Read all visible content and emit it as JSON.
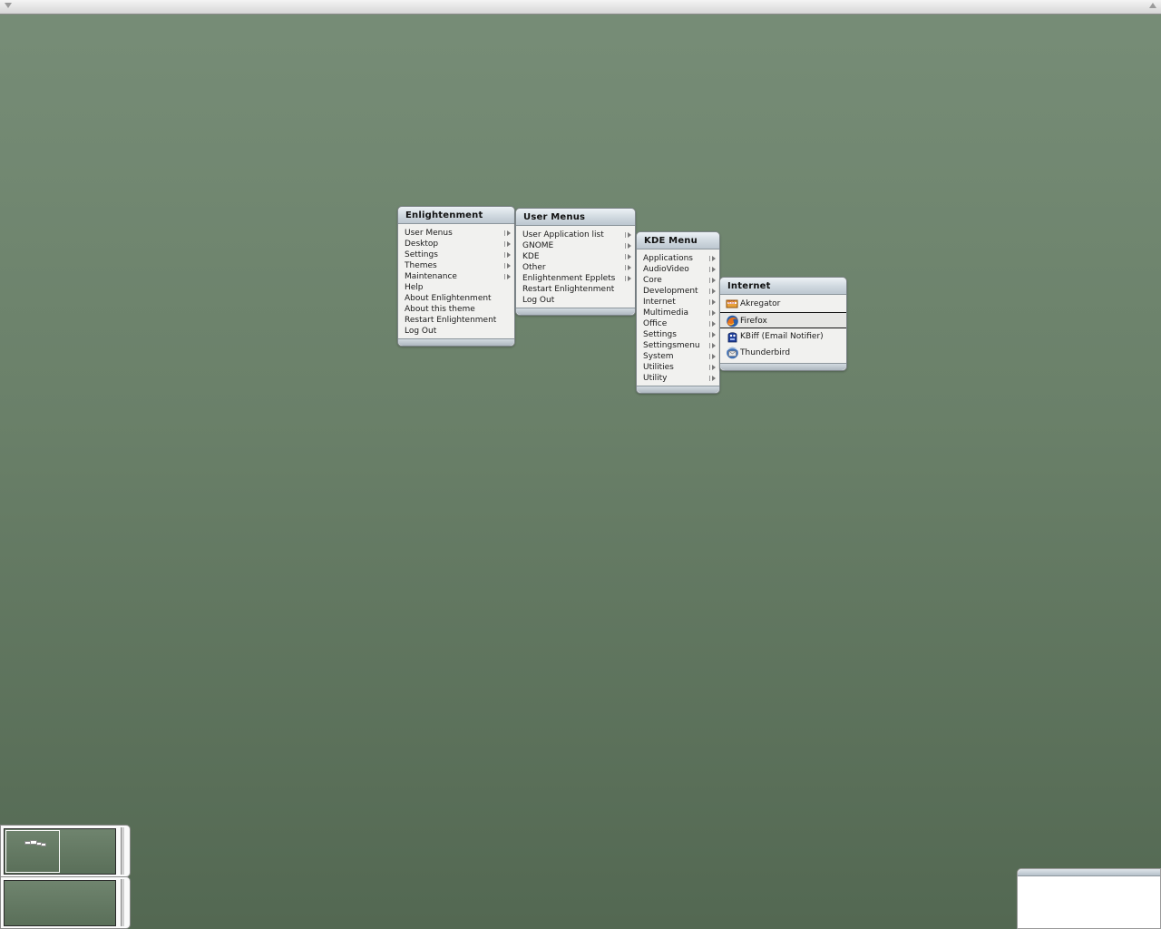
{
  "menus": {
    "enlightenment": {
      "title": "Enlightenment",
      "items": [
        {
          "label": "User Menus"
        },
        {
          "label": "Desktop"
        },
        {
          "label": "Settings"
        },
        {
          "label": "Themes"
        },
        {
          "label": "Maintenance"
        },
        {
          "label": "Help"
        },
        {
          "label": "About Enlightenment"
        },
        {
          "label": "About this theme"
        },
        {
          "label": "Restart Enlightenment"
        },
        {
          "label": "Log Out"
        }
      ]
    },
    "user_menus": {
      "title": "User Menus",
      "items": [
        {
          "label": "User Application list"
        },
        {
          "label": "GNOME"
        },
        {
          "label": "KDE"
        },
        {
          "label": "Other"
        },
        {
          "label": "Enlightenment Epplets"
        },
        {
          "label": "Restart Enlightenment"
        },
        {
          "label": "Log Out"
        }
      ]
    },
    "kde_menu": {
      "title": "KDE Menu",
      "items": [
        {
          "label": "Applications"
        },
        {
          "label": "AudioVideo"
        },
        {
          "label": "Core"
        },
        {
          "label": "Development"
        },
        {
          "label": "Internet"
        },
        {
          "label": "Multimedia"
        },
        {
          "label": "Office"
        },
        {
          "label": "Settings"
        },
        {
          "label": "Settingsmenu"
        },
        {
          "label": "System"
        },
        {
          "label": "Utilities"
        },
        {
          "label": "Utility"
        }
      ]
    },
    "internet": {
      "title": "Internet",
      "items": [
        {
          "label": "Akregator",
          "icon": "akregator-icon"
        },
        {
          "label": "Firefox",
          "icon": "firefox-icon"
        },
        {
          "label": "KBiff (Email Notifier)",
          "icon": "kbiff-icon"
        },
        {
          "label": "Thunderbird",
          "icon": "thunderbird-icon"
        }
      ]
    }
  }
}
